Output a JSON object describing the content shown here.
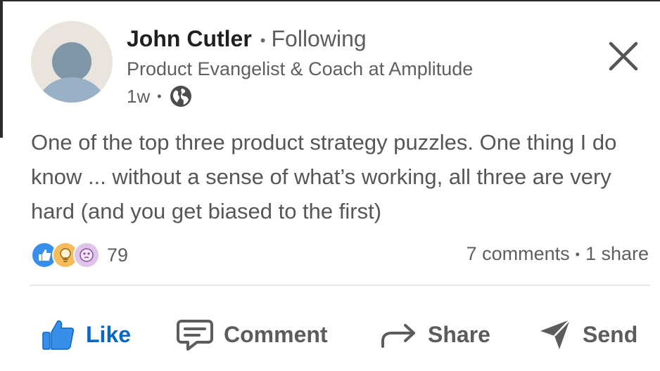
{
  "author": {
    "name": "John Cutler",
    "follow_status": "Following",
    "headline": "Product Evangelist & Coach at Amplitude",
    "time_ago": "1w",
    "separator": "•"
  },
  "post": {
    "text": "One of the top three product strategy puzzles. One thing I do know ... without a sense of what’s working, all three are very hard (and you get biased to the first)"
  },
  "social": {
    "reaction_icons": [
      "like-icon",
      "insightful-icon",
      "curious-icon"
    ],
    "reaction_count": "79",
    "comments": "7 comments",
    "shares": "1 share",
    "separator": "•"
  },
  "actions": {
    "like": "Like",
    "comment": "Comment",
    "share": "Share",
    "send": "Send"
  },
  "colors": {
    "like_blue": "#0a66c2",
    "reaction_like": "#378fe9",
    "reaction_idea": "#f5bb5c",
    "reaction_curious": "#dfc4ea",
    "muted_text": "#5f5f5f"
  }
}
